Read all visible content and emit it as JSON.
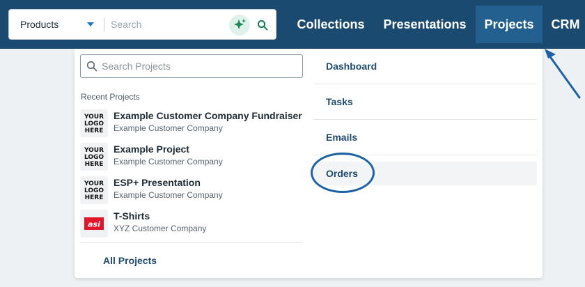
{
  "search": {
    "category": "Products",
    "placeholder": "Search",
    "ai_icon": "sparkle-icon",
    "search_icon": "magnifier-icon"
  },
  "nav": {
    "items": [
      {
        "label": "Collections",
        "active": false
      },
      {
        "label": "Presentations",
        "active": false
      },
      {
        "label": "Projects",
        "active": true
      },
      {
        "label": "CRM",
        "active": false
      }
    ]
  },
  "projects_menu": {
    "search_placeholder": "Search Projects",
    "recent_heading": "Recent Projects",
    "recent": [
      {
        "title": "Example Customer Company Fundraiser",
        "subtitle": "Example Customer Company",
        "thumb": "your-logo-here"
      },
      {
        "title": "Example Project",
        "subtitle": "Example Customer Company",
        "thumb": "your-logo-here"
      },
      {
        "title": "ESP+ Presentation",
        "subtitle": "Example Customer Company",
        "thumb": "your-logo-here"
      },
      {
        "title": "T-Shirts",
        "subtitle": "XYZ Customer Company",
        "thumb": "asi-logo"
      }
    ],
    "logo_text": [
      "YOUR",
      "LOGO",
      "HERE"
    ],
    "asi_text": "asi",
    "all_projects": "All Projects",
    "links": [
      "Dashboard",
      "Tasks",
      "Emails",
      "Orders"
    ]
  },
  "colors": {
    "topbar": "#1a4a70",
    "active_tab": "#24608f",
    "annotation": "#1c61a6",
    "link_text": "#1d4a6e"
  }
}
